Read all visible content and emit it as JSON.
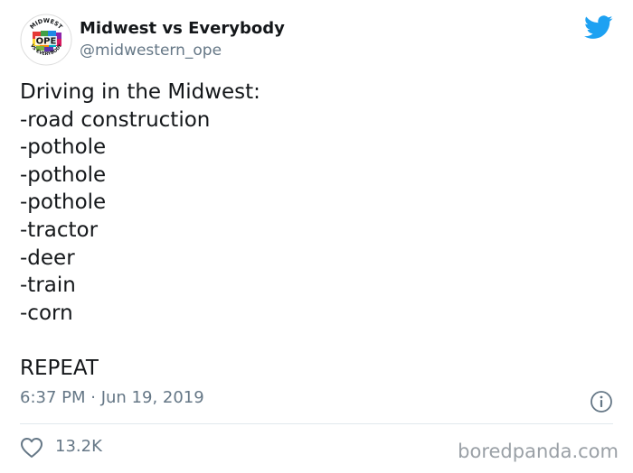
{
  "tweet": {
    "display_name": "Midwest vs Everybody",
    "handle": "@midwestern_ope",
    "avatar_text": {
      "top": "MIDWEST",
      "center": "OPE",
      "bottom": "VS EVERYBODY"
    },
    "lines": [
      "Driving in the Midwest:",
      "-road construction",
      "-pothole",
      "-pothole",
      "-pothole",
      "-tractor",
      "-deer",
      "-train",
      "-corn"
    ],
    "closing": "REPEAT",
    "timestamp": "6:37 PM · Jun 19, 2019",
    "like_count": "13.2K"
  },
  "watermark": "boredpanda.com",
  "icons": [
    "twitter-bird-icon",
    "info-icon",
    "heart-icon"
  ],
  "colors": {
    "twitter_blue": "#1da1f2",
    "text_primary": "#14171a",
    "text_secondary": "#657786",
    "divider": "#e1e8ed",
    "watermark": "#9aa0a6"
  }
}
